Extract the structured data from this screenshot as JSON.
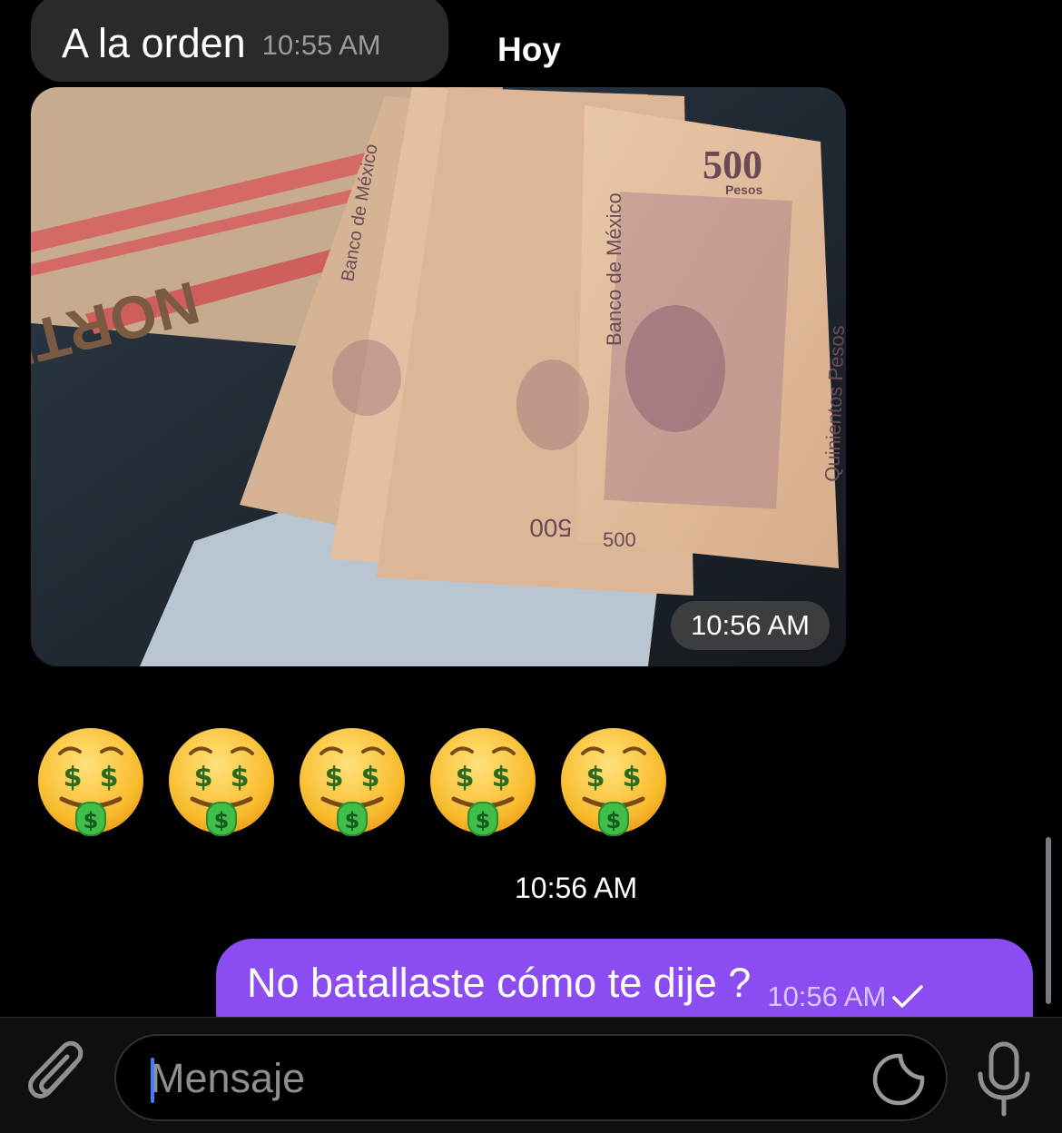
{
  "messages": {
    "incoming_text": {
      "text": "A la orden",
      "time": "10:55 AM"
    },
    "day_label": "Hoy",
    "photo": {
      "time": "10:56 AM"
    },
    "emojis": {
      "count": 5,
      "time": "10:56 AM"
    },
    "outgoing_text": {
      "text": "No batallaste cómo te dije ?",
      "time": "10:56 AM",
      "status": "sent"
    }
  },
  "photo_content": {
    "banknote_denomination": "500",
    "banknote_currency": "Pesos",
    "bank_name": "Banco de México",
    "banknote_words": "Quinientos Pesos",
    "bag_logo": "NORTE"
  },
  "composer": {
    "placeholder": "Mensaje",
    "value": ""
  },
  "colors": {
    "outgoing_bubble": "#8b4cf2",
    "incoming_bubble": "#2a2a2c",
    "caret": "#3d7bff"
  },
  "icons": {
    "attach": "paperclip-icon",
    "sticker": "sticker-icon",
    "mic": "microphone-icon",
    "read_status": "check-icon",
    "emoji": "money-mouth-face-emoji"
  }
}
